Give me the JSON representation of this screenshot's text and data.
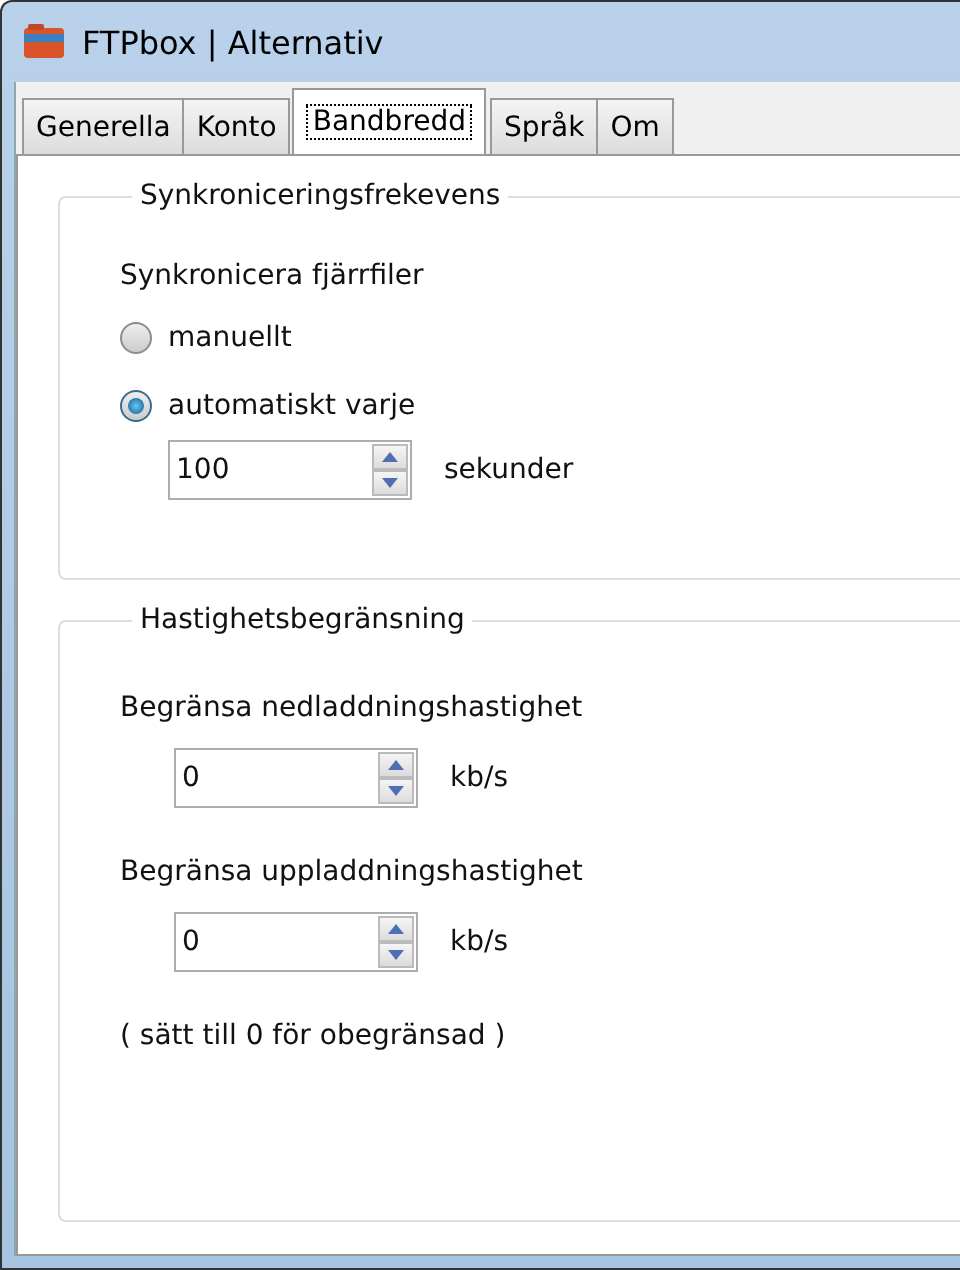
{
  "window": {
    "title": "FTPbox | Alternativ"
  },
  "tabs": [
    {
      "label": "Generella",
      "selected": false
    },
    {
      "label": "Konto",
      "selected": false
    },
    {
      "label": "Bandbredd",
      "selected": true
    },
    {
      "label": "Språk",
      "selected": false
    },
    {
      "label": "Om",
      "selected": false
    }
  ],
  "sync_group": {
    "title": "Synkroniceringsfrekevens",
    "label": "Synkronicera fjärrfiler",
    "options": [
      {
        "label": "manuellt",
        "selected": false
      },
      {
        "label": "automatiskt varje",
        "selected": true
      }
    ],
    "interval": {
      "value": "100",
      "unit": "sekunder"
    }
  },
  "speed_group": {
    "title": "Hastighetsbegränsning",
    "limits": [
      {
        "label": "Begränsa nedladdningshastighet",
        "value": "0",
        "unit": "kb/s"
      },
      {
        "label": "Begränsa uppladdningshastighet",
        "value": "0",
        "unit": "kb/s"
      }
    ],
    "note": "( sätt till 0 för obegränsad )"
  }
}
